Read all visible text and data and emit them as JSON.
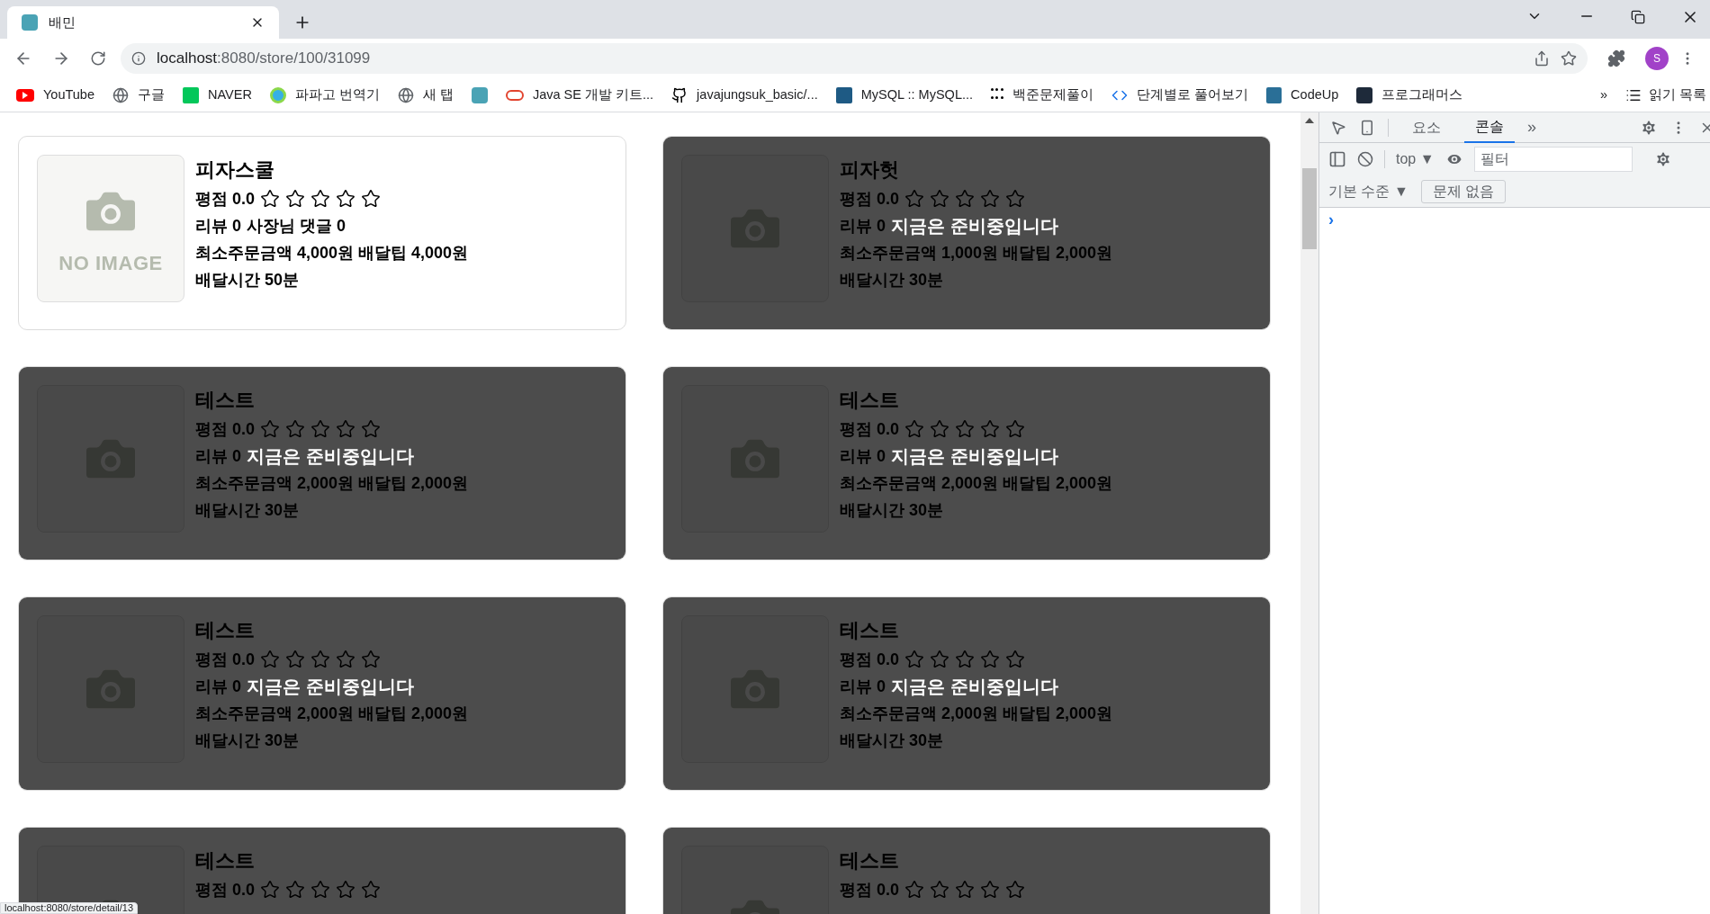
{
  "browser": {
    "tab": {
      "title": "배민",
      "selected": true
    },
    "url_host": "localhost",
    "url_path": ":8080/store/100/31099",
    "bookmarks": [
      {
        "label": "YouTube",
        "kind": "youtube"
      },
      {
        "label": "구글",
        "kind": "globe"
      },
      {
        "label": "NAVER",
        "kind": "naver"
      },
      {
        "label": "파파고 번역기",
        "kind": "papago"
      },
      {
        "label": "새 탭",
        "kind": "globe"
      },
      {
        "kind": "app"
      },
      {
        "label": "Java SE 개발 키트...",
        "kind": "oracle"
      },
      {
        "label": "javajungsuk_basic/...",
        "kind": "github"
      },
      {
        "label": "MySQL :: MySQL...",
        "kind": "mysql"
      },
      {
        "label": "백준문제풀이",
        "kind": "dots"
      },
      {
        "label": "단계별로 풀어보기",
        "kind": "code"
      },
      {
        "label": "CodeUp",
        "kind": "codeup"
      },
      {
        "label": "프로그래머스",
        "kind": "programmers"
      }
    ],
    "more": "»",
    "reading_list": "읽기 목록",
    "profile": "S"
  },
  "stores": [
    {
      "name": "피자스쿨",
      "rating": "평점 0.0",
      "stars": 0,
      "review": "리뷰 0",
      "owner_reply": "사장님 댓글 0",
      "closed": false,
      "min_order": "최소주문금액 4,000원 배달팁 4,000원",
      "delivery_time": "배달시간 50분",
      "image_text": "NO IMAGE"
    },
    {
      "name": "피자헛",
      "rating": "평점 0.0",
      "stars": 0,
      "review": "리뷰 0",
      "closed": true,
      "closed_message": "지금은 준비중입니다",
      "min_order": "최소주문금액 1,000원 배달팁 2,000원",
      "delivery_time": "배달시간 30분"
    },
    {
      "name": "테스트",
      "rating": "평점 0.0",
      "stars": 0,
      "review": "리뷰 0",
      "closed": true,
      "closed_message": "지금은 준비중입니다",
      "min_order": "최소주문금액 2,000원 배달팁 2,000원",
      "delivery_time": "배달시간 30분"
    },
    {
      "name": "테스트",
      "rating": "평점 0.0",
      "stars": 0,
      "review": "리뷰 0",
      "closed": true,
      "closed_message": "지금은 준비중입니다",
      "min_order": "최소주문금액 2,000원 배달팁 2,000원",
      "delivery_time": "배달시간 30분"
    },
    {
      "name": "테스트",
      "rating": "평점 0.0",
      "stars": 0,
      "review": "리뷰 0",
      "closed": true,
      "closed_message": "지금은 준비중입니다",
      "min_order": "최소주문금액 2,000원 배달팁 2,000원",
      "delivery_time": "배달시간 30분"
    },
    {
      "name": "테스트",
      "rating": "평점 0.0",
      "stars": 0,
      "review": "리뷰 0",
      "closed": true,
      "closed_message": "지금은 준비중입니다",
      "min_order": "최소주문금액 2,000원 배달팁 2,000원",
      "delivery_time": "배달시간 30분"
    },
    {
      "name": "테스트",
      "rating": "평점 0.0",
      "stars": 0,
      "closed": true
    },
    {
      "name": "테스트",
      "rating": "평점 0.0",
      "stars": 0,
      "closed": true
    }
  ],
  "status_bar": "localhost:8080/store/detail/13",
  "devtools": {
    "tabs": [
      {
        "label": "요소",
        "selected": false
      },
      {
        "label": "콘솔",
        "selected": true
      }
    ],
    "more": "»",
    "context": "top ▼",
    "filter_placeholder": "필터",
    "levels": "기본 수준 ▼",
    "issues": "문제 없음",
    "prompt": "›"
  }
}
